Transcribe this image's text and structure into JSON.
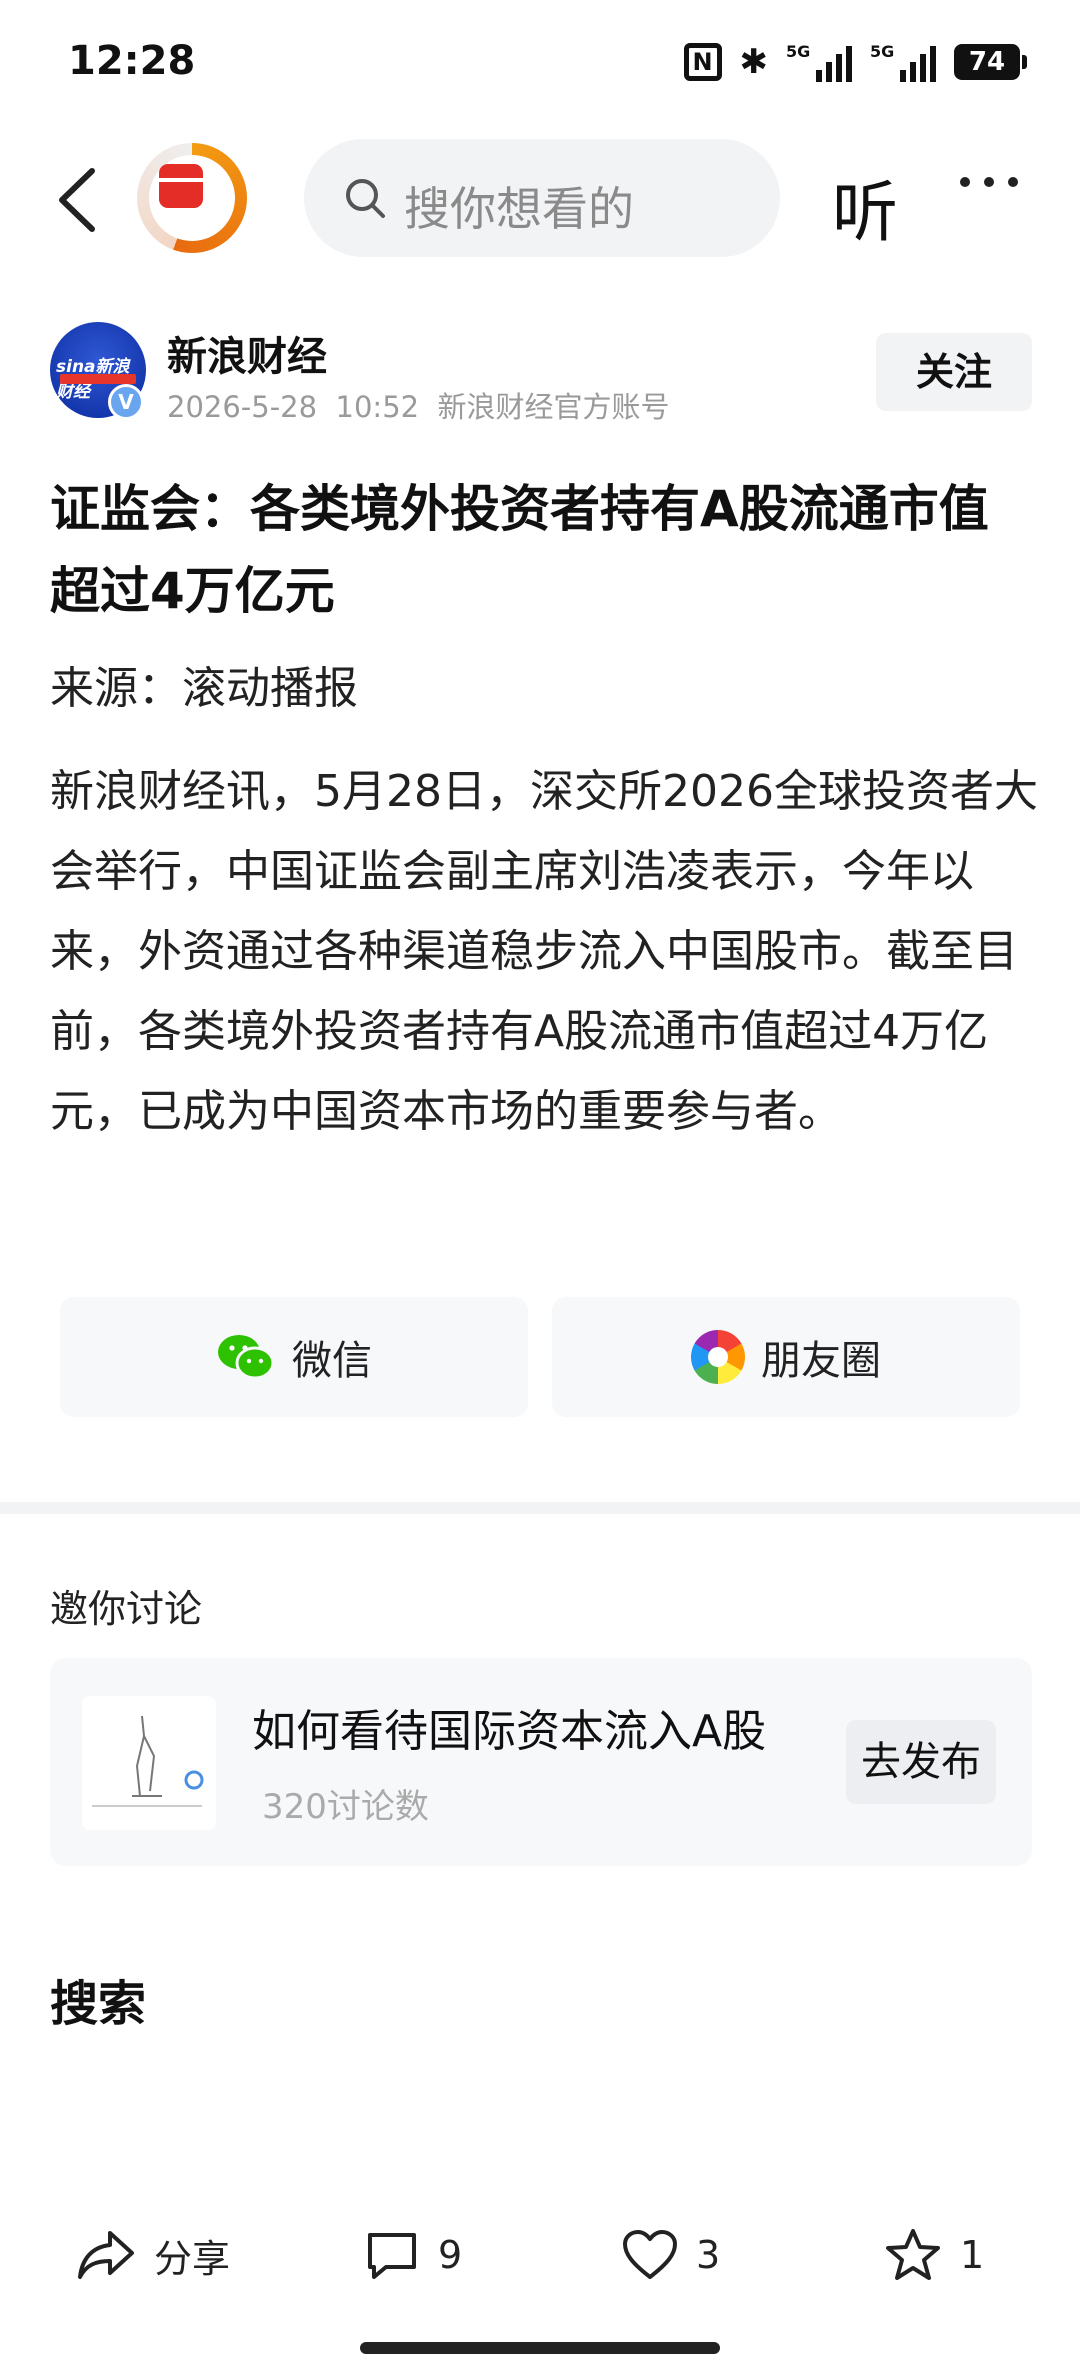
{
  "status_bar": {
    "time": "12:28",
    "nfc_label": "N",
    "signal_1_label": "5G",
    "signal_2_label": "5G",
    "battery": "74"
  },
  "nav": {
    "search_placeholder": "搜你想看的",
    "listen_label": "听"
  },
  "author": {
    "name": "新浪财经",
    "avatar_text": "sina新浪财经",
    "verify_mark": "V",
    "date": "2026-5-28",
    "time": "10:52",
    "account_type": "新浪财经官方账号",
    "follow_label": "关注"
  },
  "article": {
    "title": "证监会：各类境外投资者持有A股流通市值超过4万亿元",
    "source": "来源：滚动播报",
    "body": "新浪财经讯，5月28日，深交所2026全球投资者大会举行，中国证监会副主席刘浩凌表示，今年以来，外资通过各种渠道稳步流入中国股市。截至目前，各类境外投资者持有A股流通市值超过4万亿元，已成为中国资本市场的重要参与者。"
  },
  "share": {
    "wechat_label": "微信",
    "moments_label": "朋友圈"
  },
  "discussion": {
    "heading": "邀你讨论",
    "topic": "如何看待国际资本流入A股",
    "count": "320讨论数",
    "publish_label": "去发布"
  },
  "search_section": {
    "heading": "搜索"
  },
  "bottom_bar": {
    "share_label": "分享",
    "comments": "9",
    "likes": "3",
    "favorites": "1"
  },
  "colors": {
    "accent_red": "#e52d27",
    "accent_orange": "#f39c12",
    "wechat_green": "#2dc100",
    "muted_gray": "#9a9a9a"
  }
}
